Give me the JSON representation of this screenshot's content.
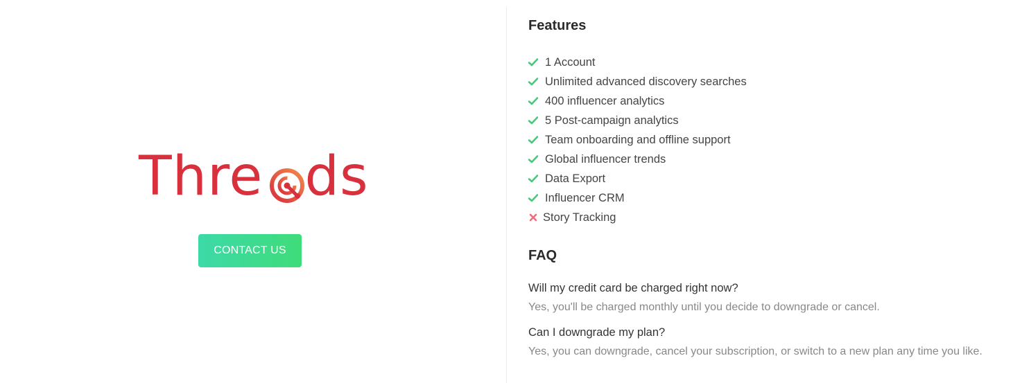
{
  "brand": {
    "logo_text": "Threads",
    "logo_color": "#d9303e",
    "logo_icon": "signal-target-icon"
  },
  "contact_button": {
    "label": "CONTACT US",
    "colors": [
      "#3dd9a8",
      "#3fdc7a"
    ]
  },
  "features": {
    "title": "Features",
    "included_icon": "check-icon",
    "excluded_icon": "cross-icon",
    "included_color": "#49c77a",
    "excluded_color": "#f26c7a",
    "items": [
      {
        "label": "1 Account",
        "included": true
      },
      {
        "label": "Unlimited advanced discovery searches",
        "included": true
      },
      {
        "label": "400 influencer analytics",
        "included": true
      },
      {
        "label": "5 Post-campaign analytics",
        "included": true
      },
      {
        "label": "Team onboarding and offline support",
        "included": true
      },
      {
        "label": "Global influencer trends",
        "included": true
      },
      {
        "label": "Data Export",
        "included": true
      },
      {
        "label": "Influencer CRM",
        "included": true
      },
      {
        "label": "Story Tracking",
        "included": false
      }
    ]
  },
  "faq": {
    "title": "FAQ",
    "items": [
      {
        "question": "Will my credit card be charged right now?",
        "answer": "Yes, you'll be charged monthly until you decide to downgrade or cancel."
      },
      {
        "question": "Can I downgrade my plan?",
        "answer": "Yes, you can downgrade, cancel your subscription, or switch to a new plan any time you like."
      }
    ]
  }
}
